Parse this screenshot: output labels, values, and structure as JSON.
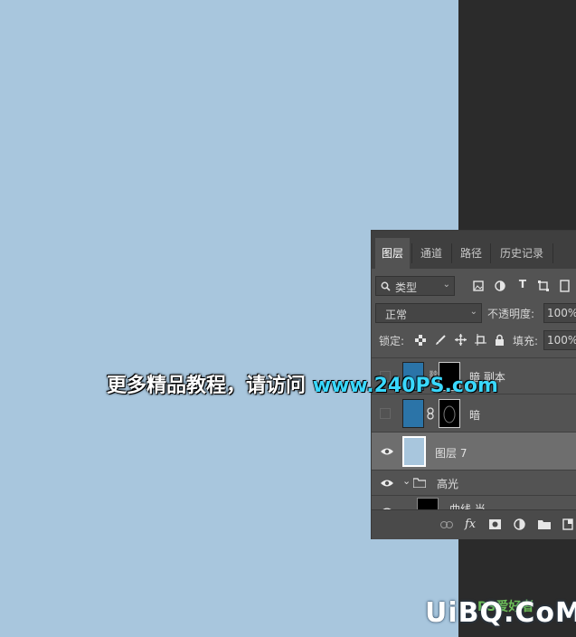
{
  "panel": {
    "tabs": [
      {
        "label": "图层",
        "active": true
      },
      {
        "label": "通道"
      },
      {
        "label": "路径"
      },
      {
        "label": "历史记录"
      }
    ],
    "filter": {
      "kind_label": "类型"
    },
    "blend": {
      "mode": "正常",
      "opacity_label": "不透明度:",
      "opacity_value": "100%"
    },
    "lock": {
      "label": "锁定:",
      "fill_label": "填充:",
      "fill_value": "100%"
    },
    "layers": [
      {
        "name": "暗 副本",
        "visible": false,
        "type": "masked",
        "color": "#2b74a8"
      },
      {
        "name": "暗",
        "visible": false,
        "type": "masked",
        "color": "#2b74a8"
      },
      {
        "name": "图层 7",
        "visible": true,
        "type": "pixel",
        "selected": true,
        "color": "#a8c6dd"
      },
      {
        "name": "高光",
        "visible": true,
        "type": "group"
      },
      {
        "name": "曲线 当",
        "visible": true,
        "type": "masked-partial"
      }
    ]
  },
  "watermark": {
    "text": "更多精品教程，请访问",
    "url": "www.240PS.com"
  },
  "logo": {
    "text": "UiBQ.CoM",
    "brand": "PS爱好者"
  },
  "colors": {
    "canvas": "#a8c6dd",
    "workspace": "#2b2b2b",
    "panel": "#535353",
    "accent_url": "#39d8ff"
  }
}
